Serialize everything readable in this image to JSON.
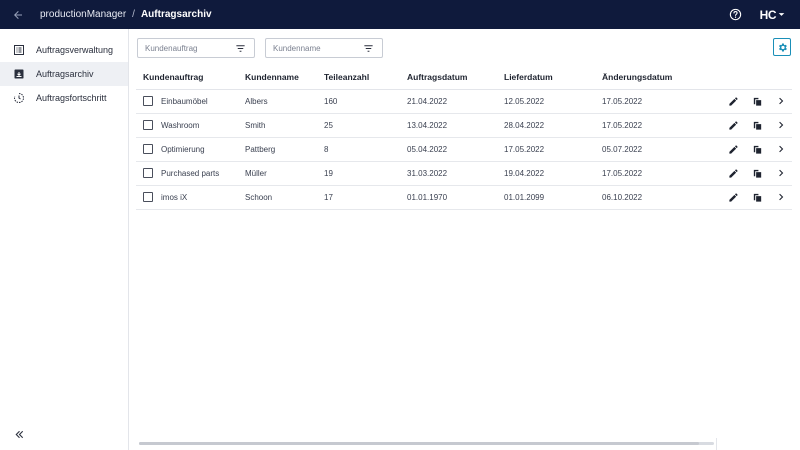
{
  "header": {
    "app_name": "productionManager",
    "separator": "/",
    "current_page": "Auftragsarchiv",
    "brand": "HC",
    "colors": {
      "bar": "#0f1a3c",
      "accent": "#1a8fb8"
    }
  },
  "sidebar": {
    "items": [
      {
        "label": "Auftragsverwaltung",
        "icon": "order-list-icon",
        "active": false
      },
      {
        "label": "Auftragsarchiv",
        "icon": "archive-icon",
        "active": true
      },
      {
        "label": "Auftragsfortschritt",
        "icon": "progress-icon",
        "active": false
      }
    ],
    "collapse_icon": "double-chevron-left-icon"
  },
  "filters": {
    "customer_order": {
      "placeholder": "Kundenauftrag",
      "value": ""
    },
    "customer_name": {
      "placeholder": "Kundenname",
      "value": ""
    }
  },
  "table": {
    "columns": [
      "Kundenauftrag",
      "Kundenname",
      "Teileanzahl",
      "Auftragsdatum",
      "Lieferdatum",
      "Änderungsdatum"
    ],
    "rows": [
      {
        "order": "Einbaumöbel",
        "customer": "Albers",
        "parts": "160",
        "order_date": "21.04.2022",
        "delivery_date": "12.05.2022",
        "changed_date": "17.05.2022"
      },
      {
        "order": "Washroom",
        "customer": "Smith",
        "parts": "25",
        "order_date": "13.04.2022",
        "delivery_date": "28.04.2022",
        "changed_date": "17.05.2022"
      },
      {
        "order": "Optimierung",
        "customer": "Pattberg",
        "parts": "8",
        "order_date": "05.04.2022",
        "delivery_date": "17.05.2022",
        "changed_date": "05.07.2022"
      },
      {
        "order": "Purchased parts",
        "customer": "Müller",
        "parts": "19",
        "order_date": "31.03.2022",
        "delivery_date": "19.04.2022",
        "changed_date": "17.05.2022"
      },
      {
        "order": "imos iX",
        "customer": "Schoon",
        "parts": "17",
        "order_date": "01.01.1970",
        "delivery_date": "01.01.2099",
        "changed_date": "06.10.2022"
      }
    ]
  }
}
